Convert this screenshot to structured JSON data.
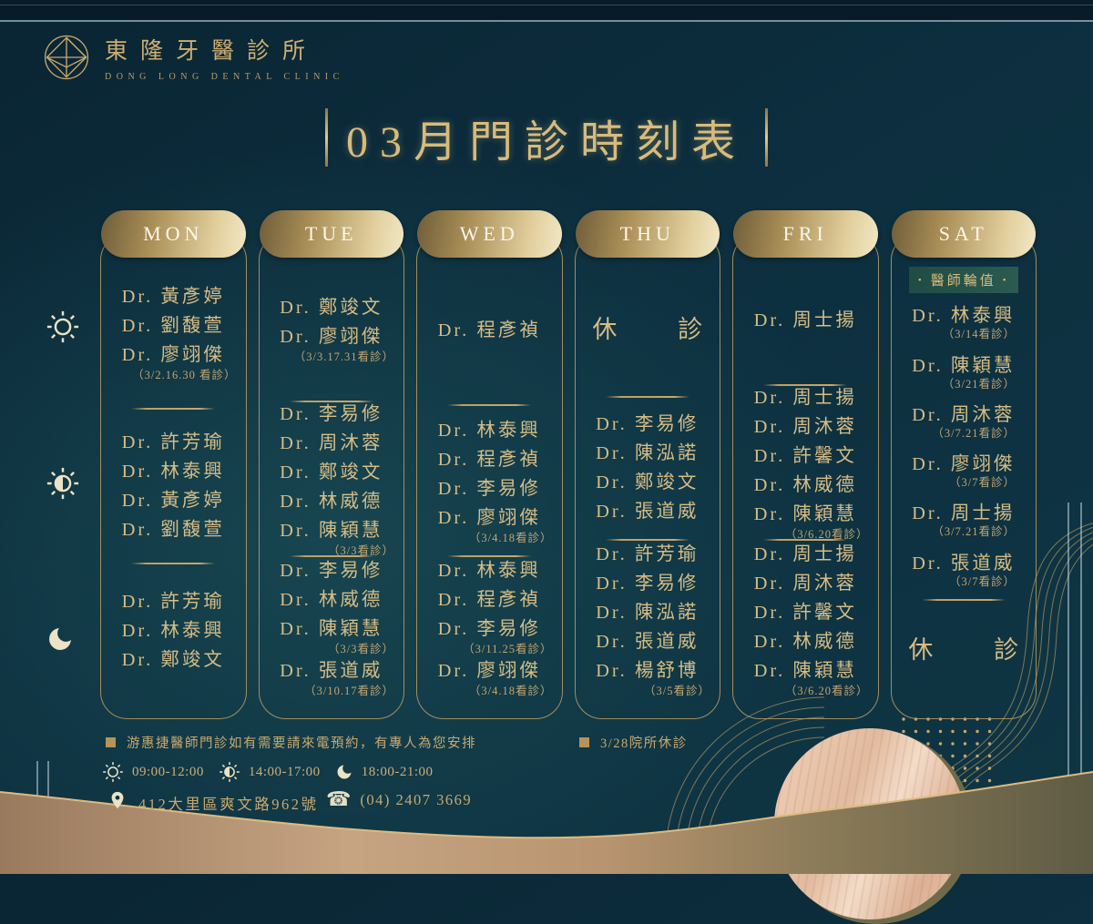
{
  "brand": {
    "logo_zh": "東隆牙醫診所",
    "logo_en": "DONG LONG DENTAL CLINIC"
  },
  "title": "03月門診時刻表",
  "colors": {
    "accent_gold": "#c9a76b",
    "background_teal": "#0d3140",
    "pill_light": "#f2e8c8",
    "pill_dark": "#6f5d3a",
    "badge_bg": "#24524a",
    "band_tan": "#c6a482",
    "wood_light": "#efd0b8"
  },
  "schedule": {
    "closed_text": "休 診",
    "rotation_badge": "醫師輪值",
    "days": [
      {
        "label": "MON",
        "sections": [
          {
            "items": [
              {
                "name": "Dr. 黃彥婷"
              },
              {
                "name": "Dr. 劉馥萱"
              },
              {
                "name": "Dr. 廖翊傑",
                "date": "（3/2.16.30 看診）"
              }
            ]
          },
          {
            "items": [
              {
                "name": "Dr. 許芳瑜"
              },
              {
                "name": "Dr. 林泰興"
              },
              {
                "name": "Dr. 黃彥婷"
              },
              {
                "name": "Dr. 劉馥萱"
              }
            ]
          },
          {
            "items": [
              {
                "name": "Dr. 許芳瑜"
              },
              {
                "name": "Dr. 林泰興"
              },
              {
                "name": "Dr. 鄭竣文"
              }
            ]
          }
        ]
      },
      {
        "label": "TUE",
        "sections": [
          {
            "items": [
              {
                "name": "Dr. 鄭竣文"
              },
              {
                "name": "Dr. 廖翊傑",
                "date": "（3/3.17.31看診）"
              }
            ]
          },
          {
            "items": [
              {
                "name": "Dr. 李易修"
              },
              {
                "name": "Dr. 周沐蓉"
              },
              {
                "name": "Dr. 鄭竣文"
              },
              {
                "name": "Dr. 林威德"
              },
              {
                "name": "Dr. 陳穎慧",
                "date": "（3/3看診）"
              }
            ]
          },
          {
            "items": [
              {
                "name": "Dr. 李易修"
              },
              {
                "name": "Dr. 林威德"
              },
              {
                "name": "Dr. 陳穎慧",
                "date": "（3/3看診）"
              },
              {
                "name": "Dr. 張道威",
                "date": "（3/10.17看診）"
              }
            ]
          }
        ]
      },
      {
        "label": "WED",
        "sections": [
          {
            "items": [
              {
                "name": "Dr. 程彥禎"
              }
            ]
          },
          {
            "items": [
              {
                "name": "Dr. 林泰興"
              },
              {
                "name": "Dr. 程彥禎"
              },
              {
                "name": "Dr. 李易修"
              },
              {
                "name": "Dr. 廖翊傑",
                "date": "（3/4.18看診）"
              }
            ]
          },
          {
            "items": [
              {
                "name": "Dr. 林泰興"
              },
              {
                "name": "Dr. 程彥禎"
              },
              {
                "name": "Dr. 李易修",
                "date": "（3/11.25看診）"
              },
              {
                "name": "Dr. 廖翊傑",
                "date": "（3/4.18看診）"
              }
            ]
          }
        ]
      },
      {
        "label": "THU",
        "sections": [
          {
            "closed": true
          },
          {
            "items": [
              {
                "name": "Dr. 李易修"
              },
              {
                "name": "Dr. 陳泓諾"
              },
              {
                "name": "Dr. 鄭竣文"
              },
              {
                "name": "Dr. 張道威"
              }
            ]
          },
          {
            "items": [
              {
                "name": "Dr. 許芳瑜"
              },
              {
                "name": "Dr. 李易修"
              },
              {
                "name": "Dr. 陳泓諾"
              },
              {
                "name": "Dr. 張道威"
              },
              {
                "name": "Dr. 楊舒博",
                "date": "（3/5看診）"
              }
            ]
          }
        ]
      },
      {
        "label": "FRI",
        "sections": [
          {
            "items": [
              {
                "name": "Dr. 周士揚"
              }
            ]
          },
          {
            "items": [
              {
                "name": "Dr. 周士揚"
              },
              {
                "name": "Dr. 周沐蓉"
              },
              {
                "name": "Dr. 許馨文"
              },
              {
                "name": "Dr. 林威德"
              },
              {
                "name": "Dr. 陳穎慧",
                "date": "（3/6.20看診）"
              }
            ]
          },
          {
            "items": [
              {
                "name": "Dr. 周士揚"
              },
              {
                "name": "Dr. 周沐蓉"
              },
              {
                "name": "Dr. 許馨文"
              },
              {
                "name": "Dr. 林威德"
              },
              {
                "name": "Dr. 陳穎慧",
                "date": "（3/6.20看診）"
              }
            ]
          }
        ]
      },
      {
        "label": "SAT",
        "badge": "醫師輪值",
        "sections": [
          {
            "items": [
              {
                "name": "Dr. 林泰興",
                "date": "（3/14看診）"
              },
              {
                "name": "Dr. 陳穎慧",
                "date": "（3/21看診）"
              },
              {
                "name": "Dr. 周沐蓉",
                "date": "（3/7.21看診）"
              },
              {
                "name": "Dr. 廖翊傑",
                "date": "（3/7看診）"
              },
              {
                "name": "Dr. 周士揚",
                "date": "（3/7.21看診）"
              },
              {
                "name": "Dr. 張道威",
                "date": "（3/7看診）"
              }
            ]
          },
          {
            "closed": true
          }
        ]
      }
    ]
  },
  "footer": {
    "notes": [
      "游惠捷醫師門診如有需要請來電預約，有專人為您安排",
      "3/28院所休診"
    ],
    "hours": [
      {
        "period": "morning",
        "time": "09:00-12:00"
      },
      {
        "period": "afternoon",
        "time": "14:00-17:00"
      },
      {
        "period": "evening",
        "time": "18:00-21:00"
      }
    ],
    "address": "412大里區爽文路962號",
    "phone": "(04) 2407 3669",
    "phone_icon_glyph": "☎"
  }
}
